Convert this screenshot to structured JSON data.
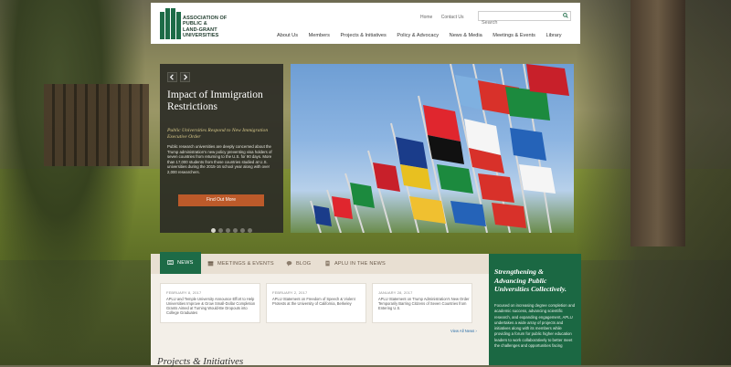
{
  "header": {
    "logo_lines": [
      "ASSOCIATION OF",
      "PUBLIC &",
      "LAND-GRANT",
      "UNIVERSITIES"
    ],
    "utility_links": [
      "Home",
      "Contact Us"
    ],
    "search_placeholder": "Search",
    "nav": [
      "About Us",
      "Members",
      "Projects & Initiatives",
      "Policy & Advocacy",
      "News & Media",
      "Meetings & Events",
      "Library"
    ]
  },
  "hero": {
    "title": "Impact of Immigration Restrictions",
    "subtitle": "Public Universities Respond to New Immigration Executive Order",
    "body": "Public research universities are deeply concerned about the Trump administration's new policy preventing visa holders of seven countries from returning to the U.S. for 90 days. More than 17,000 students from those countries studied at U.S. universities during the 2015-16 school year along with over 2,000 researchers.",
    "button": "Find Out More",
    "slide_count": 6,
    "active_slide": 1
  },
  "tabs": [
    {
      "label": "NEWS",
      "icon": "newspaper-icon",
      "active": true
    },
    {
      "label": "MEETINGS & EVENTS",
      "icon": "calendar-icon",
      "active": false
    },
    {
      "label": "BLOG",
      "icon": "chat-bubble-icon",
      "active": false
    },
    {
      "label": "APLU IN THE NEWS",
      "icon": "document-icon",
      "active": false
    }
  ],
  "news": [
    {
      "date": "FEBRUARY 8, 2017",
      "text": "APLU and Temple University Announce Effort to Help Universities Improve & Grow Small-Dollar Completion Grants Aimed at Turning Would-Be Dropouts into College Graduates"
    },
    {
      "date": "FEBRUARY 2, 2017",
      "text": "APLU Statement on Freedom of Speech & Violent Protests at the University of California, Berkeley"
    },
    {
      "date": "JANUARY 28, 2017",
      "text": "APLU Statement on Trump Administration's New Order Temporarily Barring Citizens of Seven Countries from Entering U.S."
    }
  ],
  "view_all": "View All News ›",
  "projects_title": "Projects & Initiatives",
  "sidebar": {
    "title": "Strengthening & Advancing Public Universities Collectively.",
    "body": "Focused on increasing degree completion and academic success, advancing scientific research, and expanding engagement, APLU undertakes a wide array of projects and initiatives along with its members while providing a forum for public higher education leaders to work collaboratively to better meet the challenges and opportunities facing"
  },
  "colors": {
    "brand_green": "#1d6b47",
    "button_orange": "#bc5a2a",
    "panel_dark": "#2d2d26"
  }
}
